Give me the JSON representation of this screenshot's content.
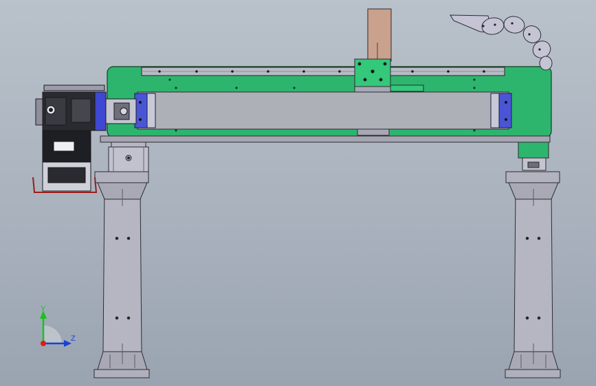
{
  "viewport": {
    "triad": {
      "y_label": "Y",
      "z_label": "Z"
    }
  },
  "colors": {
    "background_top": "#b9c1ca",
    "background_bottom": "#9aa4b1",
    "beam": "#2db56e",
    "beam_edge": "#0f3f24",
    "rail": "#b8bcc4",
    "steel": "#b3b3c0",
    "steel_edge": "#2b2b33",
    "end_block": "#4a55d6",
    "carriage_plate": "#33c87a",
    "column_post": "#c9a18c",
    "cable_chain": "#c4c4d4",
    "motor_dark": "#1e1f24",
    "axis_y": "#19c21d",
    "axis_z": "#1b3fd6",
    "axis_x": "#e01b1b"
  },
  "icons": [
    "axis-triad-icon"
  ]
}
